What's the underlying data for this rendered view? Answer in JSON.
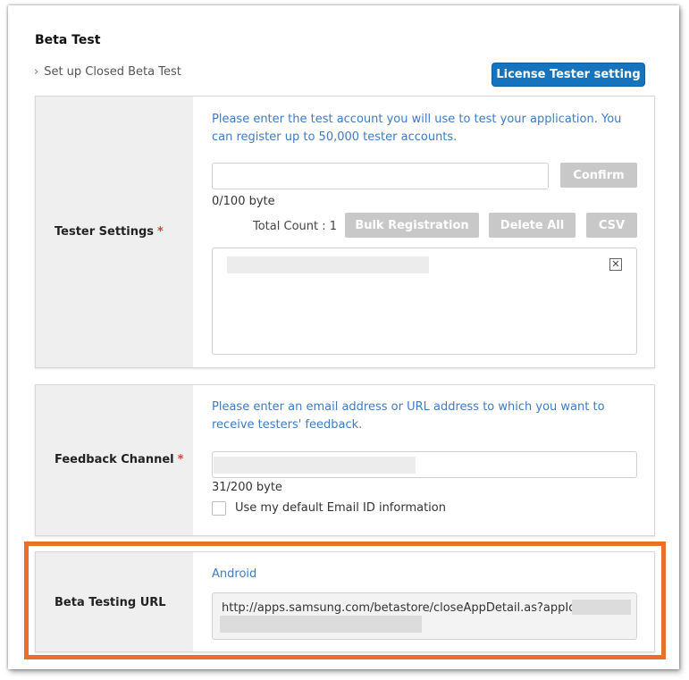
{
  "page": {
    "section_title": "Beta Test",
    "subhead": "Set up Closed Beta Test",
    "license_button": "License Tester setting"
  },
  "tester": {
    "label": "Tester Settings",
    "required_mark": "*",
    "hint": "Please enter the test account you will use to test your application. You can register up to 50,000 tester accounts.",
    "input_value": "",
    "confirm_label": "Confirm",
    "byte_count": "0/100 byte",
    "total_count": "Total Count : 1",
    "bulk_label": "Bulk Registration",
    "delete_all_label": "Delete All",
    "csv_label": "CSV",
    "remove_glyph": "✕"
  },
  "feedback": {
    "label": "Feedback Channel",
    "required_mark": "*",
    "hint": "Please enter an email address or URL address to which you want to receive testers' feedback.",
    "byte_count": "31/200 byte",
    "checkbox_label": "Use my default Email ID information",
    "checkbox_checked": false
  },
  "beta_url": {
    "label": "Beta Testing URL",
    "platform": "Android",
    "url": "http://apps.samsung.com/betastore/closeAppDetail.as?appId="
  },
  "colors": {
    "primary": "#1674be",
    "hint_text": "#3d7cc4",
    "required": "#e23b3b",
    "highlight": "#e8702a"
  }
}
